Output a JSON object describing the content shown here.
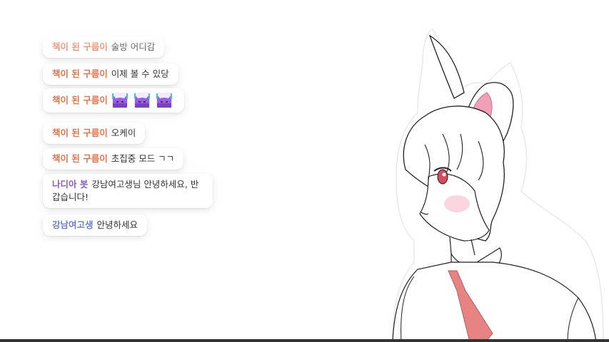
{
  "chat": {
    "messages": [
      {
        "user": "책이 된 구름이",
        "user_color": "#e8734a",
        "text": "술방 어디감",
        "faded": true
      },
      {
        "user": "책이 된 구름이",
        "user_color": "#e8734a",
        "text": "이제 볼 수 있당"
      },
      {
        "user": "책이 된 구름이",
        "user_color": "#e8734a",
        "emotes": [
          "cat-emote-icon",
          "cat-emote-icon",
          "cat-emote-icon"
        ]
      },
      {
        "user": "책이 된 구름이",
        "user_color": "#e8734a",
        "text": "오케이"
      },
      {
        "user": "책이 된 구름이",
        "user_color": "#e8734a",
        "text": "초집중 모드 ㄱㄱ"
      },
      {
        "user": "나디아 봇",
        "user_color": "#8a5cc4",
        "text": "강남여고생님 안녕하세요, 반갑습니다!"
      },
      {
        "user": "강남여고생",
        "user_color": "#6b7fd0",
        "text": "안녕하세요"
      }
    ]
  },
  "character": {
    "description_icon": "bunny-girl-avatar-icon",
    "tie_color": "#e88383",
    "ear_inner_color": "#f2a0b6"
  },
  "colors": {
    "bot_name": "#8a5cc4",
    "viewer_name": "#6b7fd0",
    "user_name": "#e8734a"
  }
}
